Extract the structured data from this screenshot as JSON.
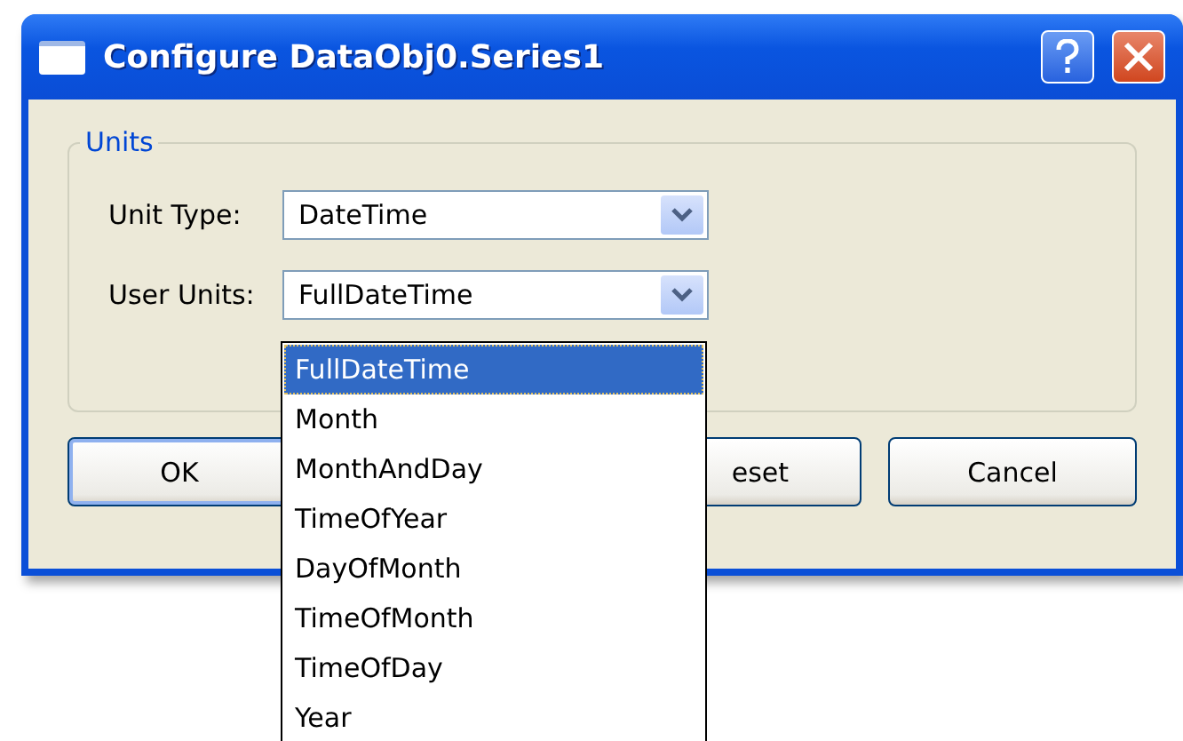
{
  "window": {
    "title": "Configure DataObj0.Series1"
  },
  "group": {
    "legend": "Units"
  },
  "fields": [
    {
      "label": "Unit Type:",
      "value": "DateTime"
    },
    {
      "label": "User Units:",
      "value": "FullDateTime",
      "open": true
    }
  ],
  "dropdown": {
    "items": [
      {
        "label": "FullDateTime",
        "selected": true
      },
      {
        "label": "Month",
        "selected": false
      },
      {
        "label": "MonthAndDay",
        "selected": false
      },
      {
        "label": "TimeOfYear",
        "selected": false
      },
      {
        "label": "DayOfMonth",
        "selected": false
      },
      {
        "label": "TimeOfMonth",
        "selected": false
      },
      {
        "label": "TimeOfDay",
        "selected": false
      },
      {
        "label": "Year",
        "selected": false
      }
    ]
  },
  "buttons": [
    {
      "label": "OK",
      "kind": "default"
    },
    {
      "label": "eset",
      "kind": "covered"
    },
    {
      "label": "Cancel",
      "kind": "normal"
    }
  ]
}
